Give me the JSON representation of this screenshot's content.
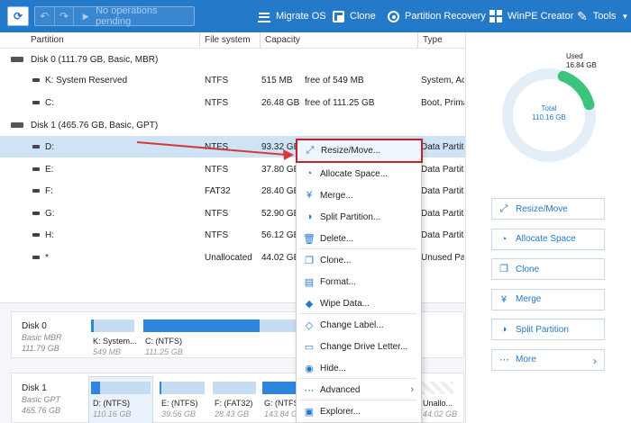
{
  "toolbar": {
    "pending": "No operations pending",
    "items": [
      {
        "label": "Migrate OS",
        "icon": "migrate-os-icon"
      },
      {
        "label": "Clone",
        "icon": "clone-icon"
      },
      {
        "label": "Partition Recovery",
        "icon": "partition-recovery-icon"
      },
      {
        "label": "WinPE Creator",
        "icon": "winpe-creator-icon"
      },
      {
        "label": "Tools",
        "icon": "tools-icon"
      }
    ]
  },
  "table": {
    "headers": {
      "partition": "Partition",
      "filesystem": "File system",
      "capacity": "Capacity",
      "type": "Type"
    },
    "disk0": {
      "label": "Disk 0 (111.79 GB, Basic, MBR)"
    },
    "disk1": {
      "label": "Disk 1 (465.76 GB, Basic, GPT)"
    },
    "rows0": [
      {
        "name": "K: System Reserved",
        "fs": "NTFS",
        "cap": "515 MB",
        "free": "free of 549 MB",
        "type": "System, Active"
      },
      {
        "name": "C:",
        "fs": "NTFS",
        "cap": "26.48 GB",
        "free": "free of 111.25 GB",
        "type": "Boot, Primary"
      }
    ],
    "rows1": [
      {
        "name": "D:",
        "fs": "NTFS",
        "cap": "93.32 GB",
        "type": "Data Partition"
      },
      {
        "name": "E:",
        "fs": "NTFS",
        "cap": "37.80 GB",
        "type": "Data Partition"
      },
      {
        "name": "F:",
        "fs": "FAT32",
        "cap": "28.40 GB",
        "type": "Data Partition"
      },
      {
        "name": "G:",
        "fs": "NTFS",
        "cap": "52.90 GB",
        "type": "Data Partition"
      },
      {
        "name": "H:",
        "fs": "NTFS",
        "cap": "56.12 GB",
        "type": "Data Partition"
      },
      {
        "name": "*",
        "fs": "Unallocated",
        "cap": "44.02 GB",
        "type": "Unused Partition"
      }
    ]
  },
  "diskmap": {
    "disk0": {
      "name": "Disk 0",
      "type": "Basic MBR",
      "size": "111.79 GB"
    },
    "disk0_parts": [
      {
        "label": "K: System...",
        "size": "549 MB",
        "used": 0.06
      },
      {
        "label": "C:  (NTFS)",
        "size": "111.25 GB",
        "used": 0.76
      }
    ],
    "disk1": {
      "name": "Disk 1",
      "type": "Basic GPT",
      "size": "465.76 GB"
    },
    "disk1_parts": [
      {
        "label": "D:  (NTFS)",
        "size": "110.16 GB",
        "used": 0.15
      },
      {
        "label": "E:  (NTFS)",
        "size": "39.56 GB",
        "used": 0.04
      },
      {
        "label": "F:  (FAT32)",
        "size": "28.43 GB",
        "used": 0.0
      },
      {
        "label": "G:  (NTFS)",
        "size": "143.84 GB",
        "used": 0.6
      },
      {
        "label": "Unallo...",
        "size": "44.02 GB",
        "used": 0.0
      }
    ]
  },
  "summary": {
    "used_label": "Used",
    "used_value": "16.84 GB",
    "total_label": "Total",
    "total_value": "110.16 GB",
    "used_fraction": 0.153
  },
  "actions": [
    {
      "label": "Resize/Move",
      "icon": "resize-move-icon"
    },
    {
      "label": "Allocate Space",
      "icon": "allocate-space-icon"
    },
    {
      "label": "Clone",
      "icon": "clone-icon"
    },
    {
      "label": "Merge",
      "icon": "merge-icon"
    },
    {
      "label": "Split Partition",
      "icon": "split-partition-icon"
    },
    {
      "label": "More",
      "icon": "more-icon"
    }
  ],
  "context_menu": [
    {
      "label": "Resize/Move...",
      "icon": "resize-move-icon"
    },
    {
      "label": "Allocate Space...",
      "icon": "allocate-space-icon"
    },
    {
      "label": "Merge...",
      "icon": "merge-icon"
    },
    {
      "label": "Split Partition...",
      "icon": "split-partition-icon"
    },
    {
      "label": "Delete...",
      "icon": "trash-icon"
    },
    {
      "label": "Clone...",
      "icon": "clone-icon"
    },
    {
      "label": "Format...",
      "icon": "format-icon"
    },
    {
      "label": "Wipe Data...",
      "icon": "wipe-data-icon"
    },
    {
      "label": "Change Label...",
      "icon": "tag-icon"
    },
    {
      "label": "Change Drive Letter...",
      "icon": "drive-letter-icon"
    },
    {
      "label": "Hide...",
      "icon": "eye-icon"
    },
    {
      "label": "Advanced",
      "icon": "ellipsis-icon"
    },
    {
      "label": "Explorer...",
      "icon": "explorer-icon"
    }
  ],
  "colors": {
    "accent": "#2479c9",
    "highlight_border": "#c8212b",
    "selected_row": "#cfe3f7",
    "donut_track": "#e4eef8",
    "donut_used": "#3cc47c"
  }
}
